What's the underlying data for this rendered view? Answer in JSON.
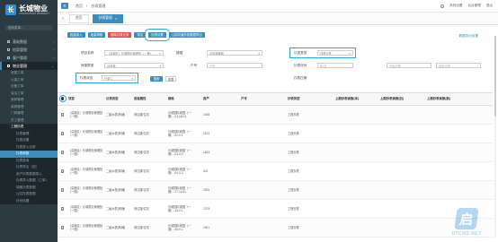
{
  "brand": {
    "name": "长城物业",
    "sub": "CHANGCHENG PROPERTY"
  },
  "sidebar": {
    "search_placeholder": "搜索菜单...",
    "groups": [
      {
        "label": "基础数据"
      },
      {
        "label": "档案管理"
      },
      {
        "label": "客户管理"
      },
      {
        "label": "物业管理",
        "active": true
      }
    ],
    "sub_items": [
      "房屋工单",
      "计量工单",
      "设备工单",
      "保洁工单",
      "营养管理",
      "装修管理",
      "门岗管理",
      "员工管理",
      "工程抄表"
    ],
    "sub2_items": [
      "抄表管理",
      "抄表设置",
      "抄表录入记录",
      "抄表审核",
      "抄表查询",
      "抄表导出（旧）",
      "用户抄表数据录入",
      "抄表导入数据（工单）",
      "调度抄表数据",
      "公共抄表数据",
      "月份设置"
    ]
  },
  "topbar": {
    "breadcrumb": [
      "首页",
      "/",
      "抄表管理"
    ],
    "right_items": [
      "系统设置",
      "后台管理",
      "退出"
    ]
  },
  "tabs": [
    {
      "label": "首页"
    },
    {
      "label": "抄表管理",
      "active": true
    }
  ],
  "toolbar": {
    "buttons": [
      {
        "label": "批量录入",
        "style": "blue"
      },
      {
        "label": "批量审核",
        "style": "blue"
      },
      {
        "label": "删除抄表记录",
        "style": "red"
      },
      {
        "label": "导出",
        "style": "blue"
      },
      {
        "label": "抄表设置",
        "style": "blue",
        "highlight": true
      },
      {
        "label": "公用共摊抄表数据导出",
        "style": "blue"
      }
    ],
    "export_link": "数据导出设置"
  },
  "filters": {
    "project_label": "项目名称",
    "project_value": "（高新区）长城物业管理处（一期）",
    "building_label": "楼幢",
    "building_placeholder": "请选择楼幢",
    "house_label": "房屋类型",
    "house_value": "请选择",
    "meter_type_label": "仪表类型",
    "meter_type_value": "抄表仪表",
    "unit_label": "户号",
    "unit_placeholder": "户号",
    "period_label": "抄表月份",
    "period_placeholder": "年/月",
    "status_label": "抄表状态",
    "status_value": "已录入",
    "date_label": "抄表日期",
    "date_from_placeholder": "开始日期",
    "date_to_placeholder": "结束日期",
    "search_button": "搜索",
    "reset_button": "重置"
  },
  "table": {
    "headers": [
      "项目",
      "仪表类型",
      "房屋属性",
      "楼栋",
      "房产",
      "户号",
      "抄表类型",
      "上期抄表读数(本)",
      "上期抄表读数(旧)",
      "上期抄表读数(新)",
      "上期抄表读数(后)"
    ],
    "rows": [
      {
        "project": "（高新区）长城物业管理处（一期）",
        "type": "二级水表(商铺)",
        "attr": "商住楼/住宅",
        "building": "长城国际家园（一期）-01-18-01",
        "room": "1408",
        "no": "",
        "reading_type": "工程抄表"
      },
      {
        "project": "（高新区）长城物业管理处（一期）",
        "type": "二级水表(商铺)",
        "attr": "商住楼/住宅",
        "building": "长城国际家园（一期）-02-0-1",
        "room": "2103",
        "no": "",
        "reading_type": "工程抄表"
      },
      {
        "project": "（高新区）长城物业管理处（一期）",
        "type": "二级水表(商铺)",
        "attr": "商住楼/住宅",
        "building": "长城国际家园（一期）-03-0-2",
        "room": "1603",
        "no": "",
        "reading_type": "工程抄表"
      },
      {
        "project": "（高新区）长城物业管理处（一期）",
        "type": "二级水表(商铺)",
        "attr": "商住楼/住宅",
        "building": "长城国际家园（一期）-04-0-3",
        "room": "501",
        "no": "",
        "reading_type": "工程抄表"
      },
      {
        "project": "（高新区）长城物业管理处（一期）",
        "type": "二级水表(商铺)",
        "attr": "商住楼/住宅",
        "building": "长城国际家园（一期）-17-11-01",
        "room": "2304",
        "no": "",
        "reading_type": "工程抄表"
      },
      {
        "project": "（高新区）长城物业管理处（一期）",
        "type": "二级水表(商铺)",
        "attr": "商住楼/住宅",
        "building": "长城国际家园（一期）-13-0-1",
        "room": "1703",
        "no": "",
        "reading_type": "工程抄表"
      },
      {
        "project": "（高新区）长城物业管理处（一期）",
        "type": "二级水表(商铺)",
        "attr": "商住楼/住宅",
        "building": "长城国际家园（一期）-06-0-1",
        "room": "1901",
        "no": "",
        "reading_type": "工程抄表"
      }
    ]
  },
  "watermark": {
    "text": "DTCMS.NET"
  },
  "colors": {
    "primary": "#3c8dbc",
    "danger": "#e04b4b",
    "highlight": "#2aa7e0",
    "sidebar": "#2c3b41"
  }
}
